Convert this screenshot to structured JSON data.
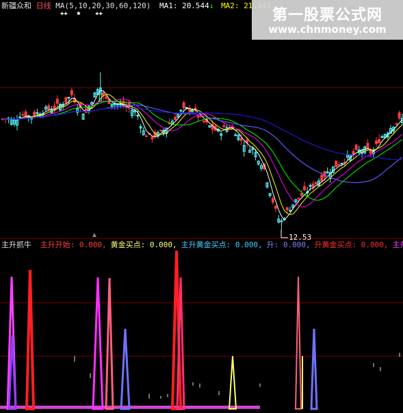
{
  "main_panel": {
    "stock_name": "新疆众和",
    "period": "日线",
    "ma_label": "MA(5,10,20,30,60,120)",
    "ma1_label": "MA1: 20.544",
    "ma1_arrow": "↓",
    "ma2_label": "MA2: 21.141",
    "markers_1": "✚✚",
    "markers_2": "✱",
    "markers_3": "✚✚",
    "low_price_label": "12.53"
  },
  "indicator_panel": {
    "name": "主升抓牛",
    "items": [
      {
        "label": "主升开始: 0.000,",
        "color": "#ff4040"
      },
      {
        "label": "黄金买点: 0.000,",
        "color": "#ffff70"
      },
      {
        "label": "主升黄金买点: 0.000,",
        "color": "#40d0ff"
      },
      {
        "label": "升: 0.000,",
        "color": "#8080ff"
      },
      {
        "label": "升黄金买点: 0.000,",
        "color": "#ff3030"
      },
      {
        "label": "主升开",
        "color": "#ff40ff"
      }
    ]
  },
  "watermark": {
    "title": "第一股票公式网",
    "url": "www.chnmoney.com"
  },
  "colors": {
    "background": "#000000",
    "up_candle": "#54ffff",
    "down_candle": "#ff3c3c",
    "grid": "#7a0000",
    "ma5": "#ffffff",
    "ma10": "#ffff00",
    "ma20": "#ff00ff",
    "ma30": "#00ff00",
    "ma60": "#5a5aff",
    "ma120": "#1a1acc"
  }
}
